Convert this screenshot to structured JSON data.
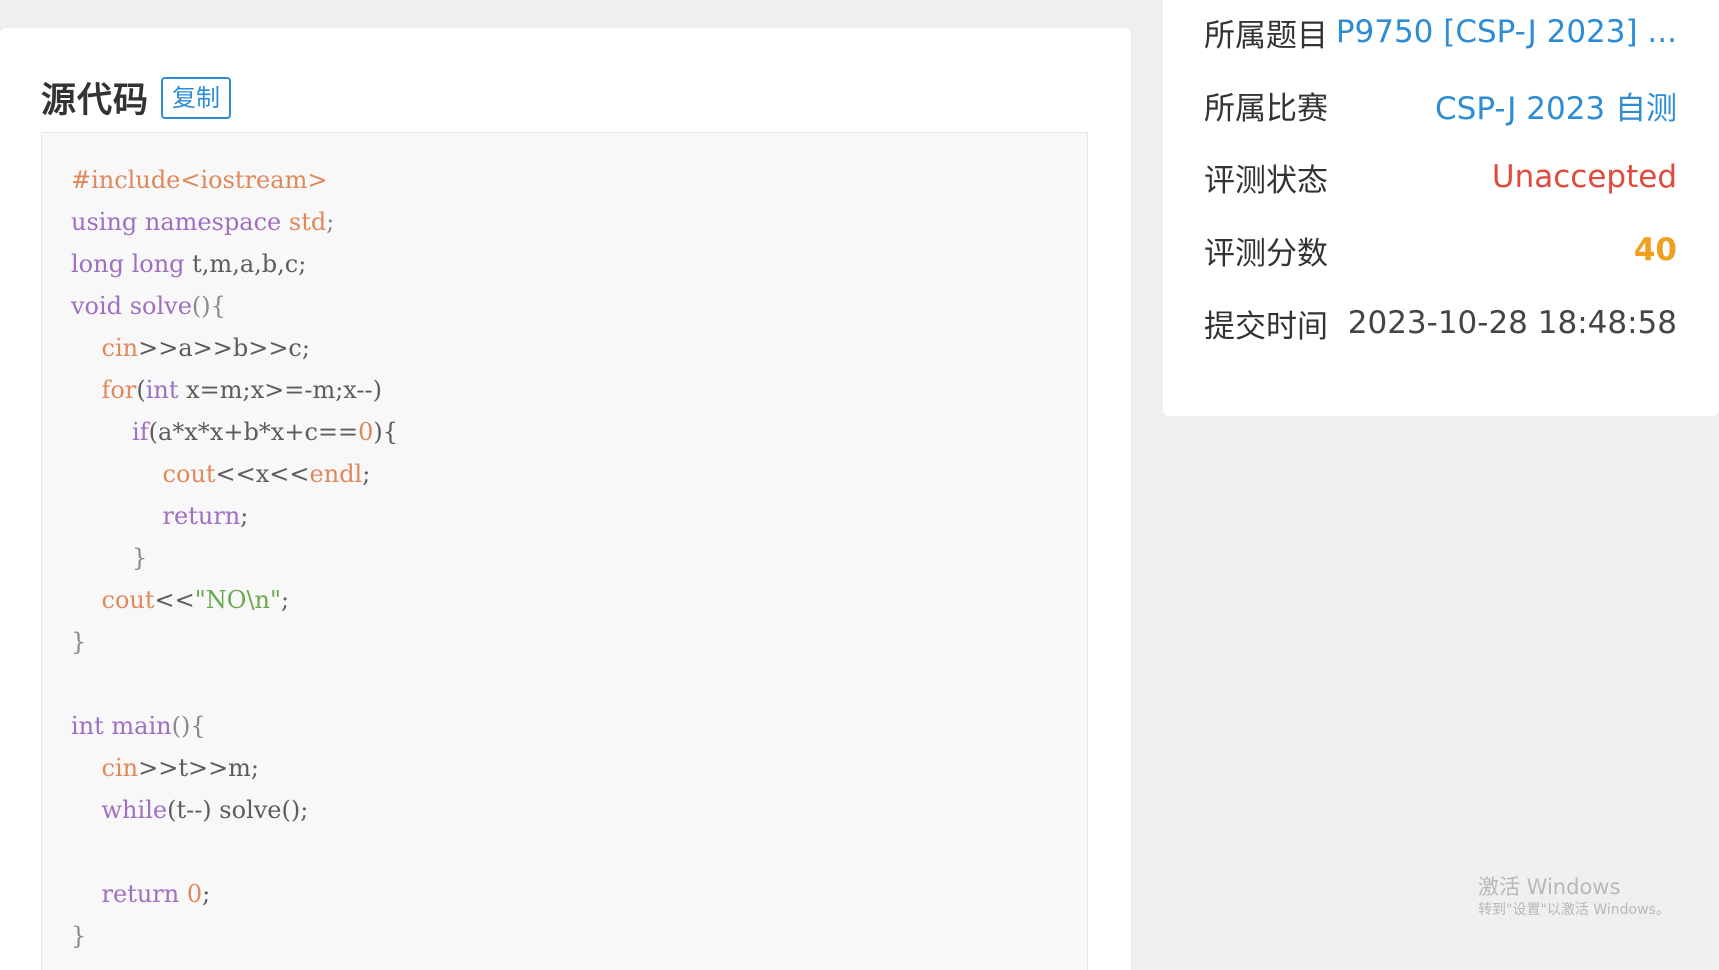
{
  "source_card": {
    "title": "源代码",
    "copy_label": "复制"
  },
  "code_lines": [
    [
      [
        "pre",
        "#include<iostream>"
      ]
    ],
    [
      [
        "kw",
        "using namespace "
      ],
      [
        "builtin",
        "std"
      ],
      [
        "punct",
        ";"
      ]
    ],
    [
      [
        "kw",
        "long long "
      ],
      [
        "plain",
        "t,m,a,b,c;"
      ]
    ],
    [
      [
        "kw",
        "void "
      ],
      [
        "kw",
        "solve"
      ],
      [
        "punct",
        "(){"
      ]
    ],
    [
      [
        "plain",
        "    "
      ],
      [
        "builtin",
        "cin"
      ],
      [
        "plain",
        ">>a>>b>>c;"
      ]
    ],
    [
      [
        "plain",
        "    "
      ],
      [
        "builtin",
        "for"
      ],
      [
        "plain",
        "("
      ],
      [
        "kw",
        "int "
      ],
      [
        "plain",
        "x=m;x>=-m;x--)"
      ]
    ],
    [
      [
        "plain",
        "        "
      ],
      [
        "kw",
        "if"
      ],
      [
        "plain",
        "(a*x*x+b*x+c=="
      ],
      [
        "num",
        "0"
      ],
      [
        "plain",
        "){"
      ]
    ],
    [
      [
        "plain",
        "            "
      ],
      [
        "builtin",
        "cout"
      ],
      [
        "plain",
        "<<x<<"
      ],
      [
        "builtin",
        "endl"
      ],
      [
        "plain",
        ";"
      ]
    ],
    [
      [
        "plain",
        "            "
      ],
      [
        "kw",
        "return"
      ],
      [
        "plain",
        ";"
      ]
    ],
    [
      [
        "plain",
        "        "
      ],
      [
        "punct",
        "}"
      ]
    ],
    [
      [
        "plain",
        "    "
      ],
      [
        "builtin",
        "cout"
      ],
      [
        "plain",
        "<<"
      ],
      [
        "str",
        "\"NO\\n\""
      ],
      [
        "plain",
        ";"
      ]
    ],
    [
      [
        "punct",
        "}"
      ]
    ],
    [
      [
        "plain",
        ""
      ]
    ],
    [
      [
        "kw",
        "int "
      ],
      [
        "kw",
        "main"
      ],
      [
        "punct",
        "(){"
      ]
    ],
    [
      [
        "plain",
        "    "
      ],
      [
        "builtin",
        "cin"
      ],
      [
        "plain",
        ">>t>>m;"
      ]
    ],
    [
      [
        "plain",
        "    "
      ],
      [
        "kw",
        "while"
      ],
      [
        "plain",
        "(t--) solve();"
      ]
    ],
    [
      [
        "plain",
        ""
      ]
    ],
    [
      [
        "plain",
        "    "
      ],
      [
        "kw",
        "return "
      ],
      [
        "num",
        "0"
      ],
      [
        "plain",
        ";"
      ]
    ],
    [
      [
        "punct",
        "}"
      ]
    ]
  ],
  "info": {
    "problem_label": "所属题目",
    "problem_value": "P9750 [CSP-J 2023] ...",
    "contest_label": "所属比赛",
    "contest_value": "CSP-J 2023 自测",
    "status_label": "评测状态",
    "status_value": "Unaccepted",
    "score_label": "评测分数",
    "score_value": "40",
    "time_label": "提交时间",
    "time_value": "2023-10-28 18:48:58"
  },
  "watermark": {
    "title": "激活 Windows",
    "subtitle": "转到\"设置\"以激活 Windows。"
  },
  "colors": {
    "link": "#2d8cd3",
    "status_red": "#e04b3c",
    "score_orange": "#f0a020",
    "keyword": "#a06fc0",
    "builtin": "#e0885a",
    "string": "#6aa84f"
  }
}
